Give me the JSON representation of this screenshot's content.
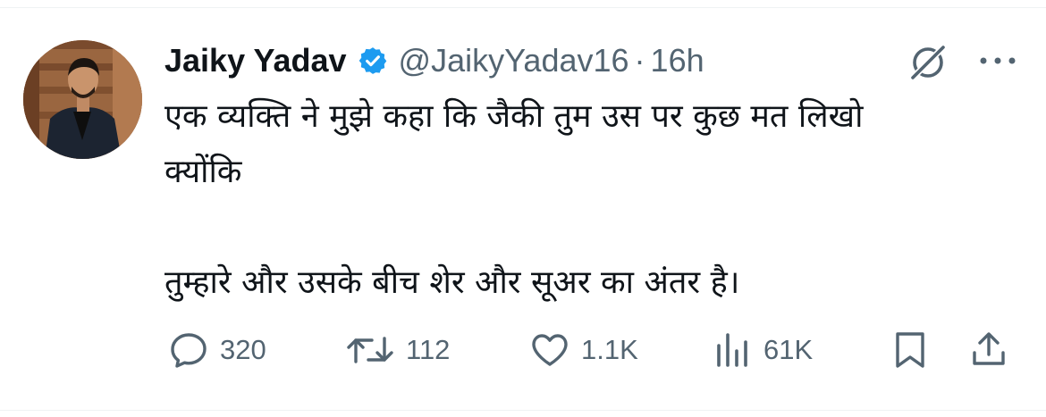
{
  "tweet": {
    "author_name": "Jaiky Yadav",
    "handle": "@JaikyYadav16",
    "separator": "·",
    "time": "16h",
    "text": "एक व्यक्ति ने मुझे कहा कि जैकी तुम उस पर कुछ मत लिखो\nक्योंकि\n\nतुम्हारे और उसके बीच शेर और सूअर का अंतर है।",
    "verified": true
  },
  "actions": {
    "reply_count": "320",
    "retweet_count": "112",
    "like_count": "1.1K",
    "views_count": "61K"
  },
  "icons": {
    "verified": "verified-badge-icon",
    "grok": "grok-icon",
    "more": "more-icon",
    "reply": "reply-icon",
    "retweet": "retweet-icon",
    "like": "heart-icon",
    "views": "views-icon",
    "bookmark": "bookmark-icon",
    "share": "share-icon"
  },
  "colors": {
    "text_primary": "#0f1419",
    "text_secondary": "#536471",
    "verified_blue": "#1d9bf0",
    "divider": "#eff3f4"
  }
}
